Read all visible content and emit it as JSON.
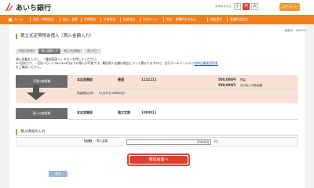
{
  "header": {
    "logo_text": "あいち銀行",
    "font_size_label": "文字の大きさ",
    "font_small": "小",
    "font_medium": "中",
    "font_large": "大",
    "logout": "ログアウト"
  },
  "nav": {
    "home": "ホーム",
    "items": [
      "残高・明細照会",
      "振込・振替",
      "定期預金",
      "外貨預金",
      "投資信託",
      "住宅ローン",
      "税金・各種料金の払込",
      "諸届受付",
      "各種利用設定"
    ]
  },
  "screen_id": "画面ID：BAI002",
  "page_title": "積立式定期預金預入（預入金額入力）",
  "steps": [
    "市場口座選択",
    "預入金額入力",
    "預入内容確認",
    "預入完了"
  ],
  "instructions": {
    "line1": "預入金額を入力し、「確認画面へ」ボタンを押してください。",
    "line2_a": "※1回あたり、一回お1万～2,999,999円までの預入が可能です。最低預入金額は商品によって異なりますので、当行ホームページより",
    "line2_link": "各商品概要説明書",
    "line3": "をご確認ください。"
  },
  "source": {
    "label": "引落口座情報",
    "branch": "本店営業部",
    "type": "普通",
    "number": "1111111",
    "balance": "500,000円",
    "balance_label": "残高",
    "available": "500,000円",
    "available_label": "お引出し可能金額",
    "time_label": "残高照会日時",
    "time_value": "01月30日 08時30分"
  },
  "dest": {
    "label": "預入口座情報",
    "branch": "本店営業部",
    "type": "積立定期",
    "number": "1000011"
  },
  "input_section": {
    "title": "預入情報の入力",
    "required": "[必須]",
    "label": "預入金額",
    "value": "100000",
    "unit": "円"
  },
  "buttons": {
    "confirm": "確認画面へ",
    "back": "戻る"
  },
  "colors": {
    "nav_orange": "#ef7e1f",
    "brand_red": "#d9412f",
    "band_pink": "#f7e2d5"
  }
}
